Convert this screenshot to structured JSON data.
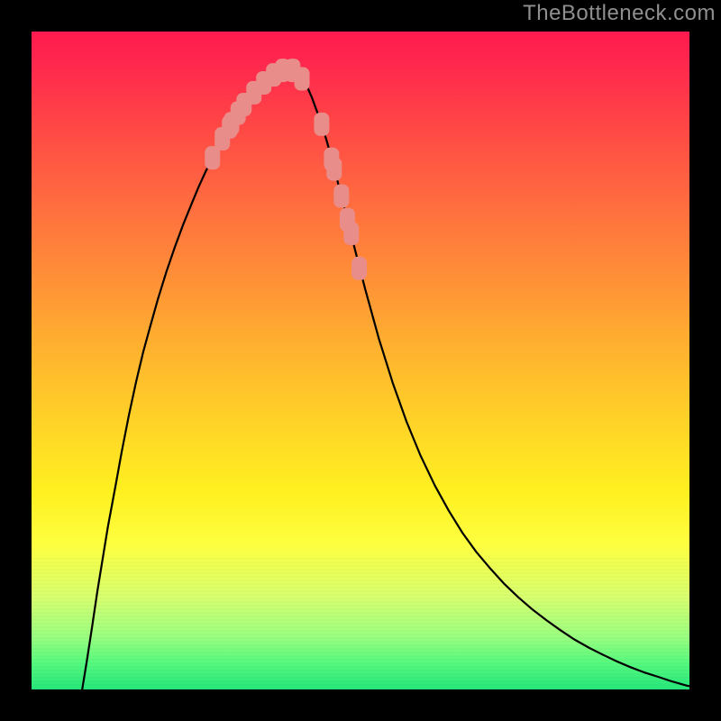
{
  "watermark": {
    "text": "TheBottleneck.com"
  },
  "chart_data": {
    "type": "line",
    "title": "",
    "xlabel": "",
    "ylabel": "",
    "xlim": [
      0,
      100
    ],
    "ylim": [
      0,
      100
    ],
    "colors": {
      "curve": "#000000",
      "marker": "#e98d8a",
      "gradient_top": "#ff1a4f",
      "gradient_bottom": "#25e77a",
      "frame": "#000000"
    },
    "series": [
      {
        "name": "bottleneck-curve",
        "mode": "line",
        "points": [
          [
            7.7,
            0.0
          ],
          [
            8.4,
            4.3
          ],
          [
            9.2,
            9.5
          ],
          [
            10.0,
            14.9
          ],
          [
            10.8,
            19.8
          ],
          [
            11.6,
            24.7
          ],
          [
            12.7,
            30.6
          ],
          [
            13.7,
            36.1
          ],
          [
            14.8,
            41.7
          ],
          [
            15.9,
            46.8
          ],
          [
            17.0,
            51.4
          ],
          [
            18.1,
            55.4
          ],
          [
            19.2,
            59.3
          ],
          [
            20.5,
            63.5
          ],
          [
            21.8,
            67.3
          ],
          [
            23.1,
            70.8
          ],
          [
            24.2,
            73.5
          ],
          [
            25.4,
            76.4
          ],
          [
            26.5,
            78.8
          ],
          [
            27.2,
            80.2
          ],
          [
            28.2,
            82.2
          ],
          [
            29.4,
            84.4
          ],
          [
            30.5,
            86.3
          ],
          [
            31.2,
            87.3
          ],
          [
            31.9,
            88.3
          ],
          [
            32.7,
            89.4
          ],
          [
            33.4,
            90.3
          ],
          [
            34.2,
            91.2
          ],
          [
            34.9,
            91.9
          ],
          [
            35.7,
            92.6
          ],
          [
            36.4,
            93.2
          ],
          [
            37.2,
            93.7
          ],
          [
            37.8,
            94.0
          ],
          [
            38.6,
            94.2
          ],
          [
            39.1,
            94.2
          ],
          [
            39.6,
            94.2
          ],
          [
            40.4,
            93.6
          ],
          [
            41.1,
            92.8
          ],
          [
            41.9,
            91.6
          ],
          [
            42.6,
            90.0
          ],
          [
            43.7,
            87.0
          ],
          [
            44.8,
            83.6
          ],
          [
            45.9,
            79.7
          ],
          [
            46.6,
            76.9
          ],
          [
            47.3,
            74.1
          ],
          [
            48.1,
            71.1
          ],
          [
            49.2,
            66.7
          ],
          [
            50.7,
            60.9
          ],
          [
            52.8,
            53.3
          ],
          [
            54.9,
            46.6
          ],
          [
            57.0,
            40.7
          ],
          [
            59.1,
            35.6
          ],
          [
            61.3,
            31.0
          ],
          [
            63.4,
            27.2
          ],
          [
            65.5,
            23.8
          ],
          [
            67.6,
            20.9
          ],
          [
            69.8,
            18.3
          ],
          [
            71.9,
            16.0
          ],
          [
            74.0,
            14.0
          ],
          [
            76.2,
            12.1
          ],
          [
            78.3,
            10.5
          ],
          [
            80.4,
            9.0
          ],
          [
            82.5,
            7.6
          ],
          [
            84.8,
            6.3
          ],
          [
            86.8,
            5.3
          ],
          [
            88.9,
            4.3
          ],
          [
            91.0,
            3.4
          ],
          [
            93.1,
            2.6
          ],
          [
            95.3,
            1.9
          ],
          [
            97.4,
            1.2
          ],
          [
            99.5,
            0.6
          ],
          [
            100.0,
            0.5
          ]
        ]
      },
      {
        "name": "markers-left-branch",
        "mode": "markers",
        "points": [
          [
            27.5,
            80.8
          ],
          [
            29.0,
            83.7
          ],
          [
            30.1,
            85.5
          ],
          [
            30.4,
            86.0
          ],
          [
            31.4,
            87.6
          ],
          [
            32.3,
            88.9
          ],
          [
            33.8,
            90.7
          ],
          [
            35.3,
            92.2
          ],
          [
            36.8,
            93.4
          ],
          [
            38.2,
            94.1
          ]
        ]
      },
      {
        "name": "markers-right-branch",
        "mode": "markers",
        "points": [
          [
            39.7,
            94.1
          ],
          [
            41.1,
            92.8
          ],
          [
            44.1,
            85.9
          ],
          [
            45.6,
            80.6
          ],
          [
            46.0,
            79.1
          ],
          [
            47.1,
            75.0
          ],
          [
            48.0,
            71.4
          ],
          [
            48.6,
            69.3
          ],
          [
            49.8,
            64.0
          ]
        ]
      }
    ]
  }
}
